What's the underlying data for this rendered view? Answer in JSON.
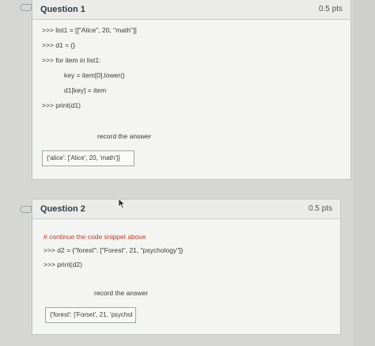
{
  "questions": [
    {
      "title": "Question 1",
      "points": "0.5 pts",
      "lines": [
        ">>> list1 = [[\"Alice\", 20, \"math\"]]",
        ">>> d1 = {}",
        ">>> for item in list1:",
        "key = item[0].lower()",
        "d1[key] = item",
        ">>> print(d1)"
      ],
      "prompt": "record the answer",
      "answer": "{'alice': ['Alice', 20, 'math']}"
    },
    {
      "title": "Question 2",
      "points": "0.5 pts",
      "comment": "# continue the code snippet above",
      "lines": [
        ">>> d2 = {\"forest\": [\"Forest\", 21, \"psychology\"]}",
        ">>> print(d2)"
      ],
      "prompt": "record the answer",
      "answer": "{'forest': ['Forset', 21, 'psychol"
    }
  ]
}
